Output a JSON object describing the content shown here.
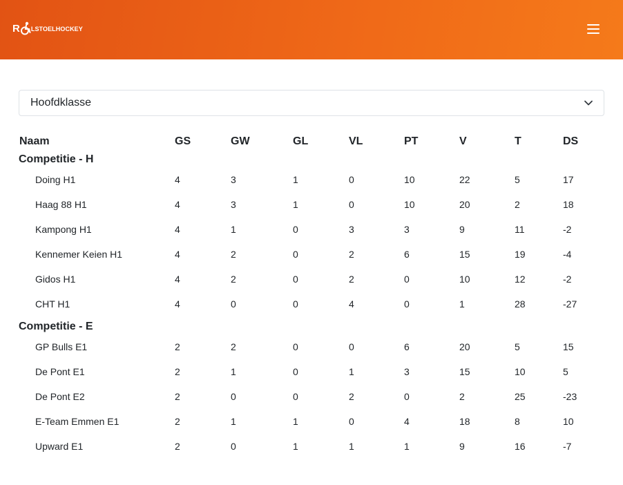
{
  "header": {
    "logo_prefix": "R",
    "logo_text": "LSTOELHOCKEY",
    "logo_full": "ROLSTOELHOCKEY",
    "menu_icon": "hamburger-menu-icon",
    "brand_color": "#f06a18"
  },
  "filter": {
    "selected": "Hoofdklasse",
    "icon": "chevron-down-icon"
  },
  "table": {
    "columns": [
      "Naam",
      "GS",
      "GW",
      "GL",
      "VL",
      "PT",
      "V",
      "T",
      "DS"
    ],
    "groups": [
      {
        "name": "Competitie - H",
        "rows": [
          {
            "name": "Doing H1",
            "gs": "4",
            "gw": "3",
            "gl": "1",
            "vl": "0",
            "pt": "10",
            "v": "22",
            "t": "5",
            "ds": "17"
          },
          {
            "name": "Haag 88 H1",
            "gs": "4",
            "gw": "3",
            "gl": "1",
            "vl": "0",
            "pt": "10",
            "v": "20",
            "t": "2",
            "ds": "18"
          },
          {
            "name": "Kampong H1",
            "gs": "4",
            "gw": "1",
            "gl": "0",
            "vl": "3",
            "pt": "3",
            "v": "9",
            "t": "11",
            "ds": "-2"
          },
          {
            "name": "Kennemer Keien H1",
            "gs": "4",
            "gw": "2",
            "gl": "0",
            "vl": "2",
            "pt": "6",
            "v": "15",
            "t": "19",
            "ds": "-4"
          },
          {
            "name": "Gidos H1",
            "gs": "4",
            "gw": "2",
            "gl": "0",
            "vl": "2",
            "pt": "0",
            "v": "10",
            "t": "12",
            "ds": "-2"
          },
          {
            "name": "CHT H1",
            "gs": "4",
            "gw": "0",
            "gl": "0",
            "vl": "4",
            "pt": "0",
            "v": "1",
            "t": "28",
            "ds": "-27"
          }
        ]
      },
      {
        "name": "Competitie - E",
        "rows": [
          {
            "name": "GP Bulls E1",
            "gs": "2",
            "gw": "2",
            "gl": "0",
            "vl": "0",
            "pt": "6",
            "v": "20",
            "t": "5",
            "ds": "15"
          },
          {
            "name": "De Pont E1",
            "gs": "2",
            "gw": "1",
            "gl": "0",
            "vl": "1",
            "pt": "3",
            "v": "15",
            "t": "10",
            "ds": "5"
          },
          {
            "name": "De Pont E2",
            "gs": "2",
            "gw": "0",
            "gl": "0",
            "vl": "2",
            "pt": "0",
            "v": "2",
            "t": "25",
            "ds": "-23"
          },
          {
            "name": "E-Team Emmen E1",
            "gs": "2",
            "gw": "1",
            "gl": "1",
            "vl": "0",
            "pt": "4",
            "v": "18",
            "t": "8",
            "ds": "10"
          },
          {
            "name": "Upward E1",
            "gs": "2",
            "gw": "0",
            "gl": "1",
            "vl": "1",
            "pt": "1",
            "v": "9",
            "t": "16",
            "ds": "-7"
          }
        ]
      }
    ]
  }
}
